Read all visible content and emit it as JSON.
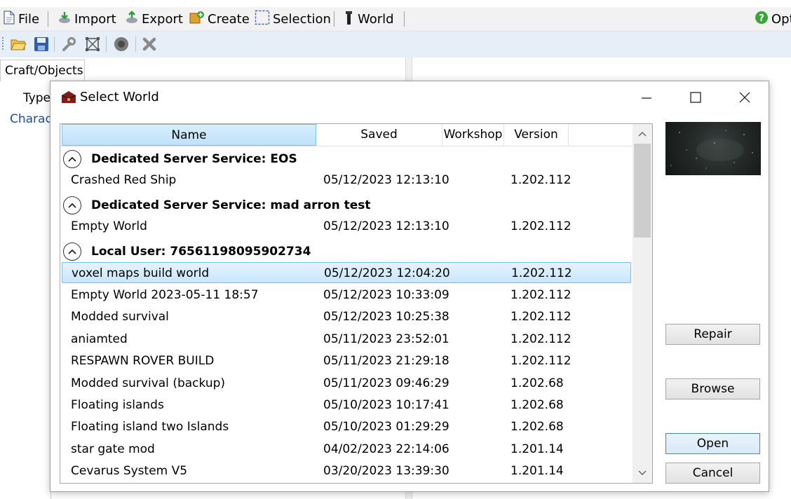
{
  "menu": {
    "items": [
      {
        "id": "file",
        "label": "File",
        "icon": "document-icon"
      },
      {
        "id": "import",
        "label": "Import",
        "icon": "import-icon"
      },
      {
        "id": "export",
        "label": "Export",
        "icon": "export-icon"
      },
      {
        "id": "create",
        "label": "Create",
        "icon": "create-icon"
      },
      {
        "id": "selection",
        "label": "Selection",
        "icon": "selection-icon"
      },
      {
        "id": "world",
        "label": "World",
        "icon": "world-icon"
      }
    ],
    "options_label": "Opt"
  },
  "left_tab": "Craft/Objects",
  "left_panel": {
    "column_header": "Type",
    "row_text": "Charact"
  },
  "dialog": {
    "title": "Select World",
    "columns": [
      "Name",
      "Saved",
      "Workshop",
      "Version"
    ],
    "groups": [
      {
        "title": "Dedicated Server Service: EOS",
        "rows": [
          {
            "name": "Crashed Red Ship",
            "saved": "05/12/2023 12:13:10",
            "workshop": "",
            "version": "1.202.112"
          }
        ]
      },
      {
        "title": "Dedicated Server Service: mad arron test",
        "rows": [
          {
            "name": "Empty World",
            "saved": "05/12/2023 12:13:10",
            "workshop": "",
            "version": "1.202.112"
          }
        ]
      },
      {
        "title": "Local User: 76561198095902734",
        "rows": [
          {
            "name": "voxel maps build world",
            "saved": "05/12/2023 12:04:20",
            "workshop": "",
            "version": "1.202.112",
            "selected": true
          },
          {
            "name": "Empty World 2023-05-11 18:57",
            "saved": "05/12/2023 10:33:09",
            "workshop": "",
            "version": "1.202.112"
          },
          {
            "name": "Modded survival",
            "saved": "05/12/2023 10:25:38",
            "workshop": "",
            "version": "1.202.112"
          },
          {
            "name": "aniamted",
            "saved": "05/11/2023 23:52:01",
            "workshop": "",
            "version": "1.202.112"
          },
          {
            "name": "RESPAWN ROVER BUILD",
            "saved": "05/11/2023 21:29:18",
            "workshop": "",
            "version": "1.202.112"
          },
          {
            "name": "Modded survival (backup)",
            "saved": "05/11/2023 09:46:29",
            "workshop": "",
            "version": "1.202.68"
          },
          {
            "name": "Floating islands",
            "saved": "05/10/2023 10:17:41",
            "workshop": "",
            "version": "1.202.68"
          },
          {
            "name": "Floating island two Islands",
            "saved": "05/10/2023 01:29:29",
            "workshop": "",
            "version": "1.202.68"
          },
          {
            "name": "star gate mod",
            "saved": "04/02/2023 22:14:06",
            "workshop": "",
            "version": "1.201.14"
          },
          {
            "name": "Cevarus System V5",
            "saved": "03/20/2023 13:39:30",
            "workshop": "",
            "version": "1.201.14"
          }
        ]
      }
    ],
    "buttons": {
      "repair": "Repair",
      "browse": "Browse",
      "open": "Open",
      "cancel": "Cancel"
    }
  },
  "colors": {
    "selection": "#c7e6fd",
    "accent": "#3d87cc",
    "toolbar": "#e6eef8"
  }
}
